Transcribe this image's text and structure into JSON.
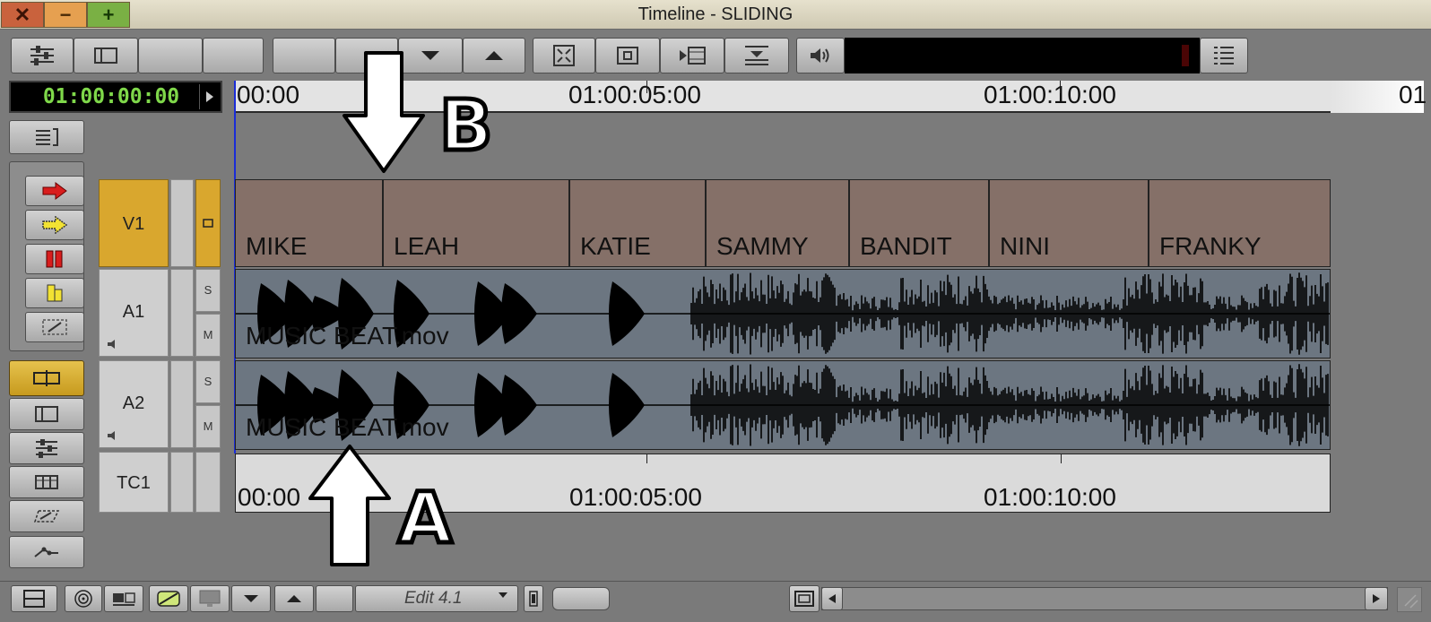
{
  "window": {
    "title": "Timeline - SLIDING",
    "close_icon": "✕",
    "minimize_icon": "−",
    "maximize_icon": "+"
  },
  "timecode": {
    "current": "01:00:00:00"
  },
  "ruler": {
    "labels": [
      "00:00",
      "01:00:05:00",
      "01:00:10:00",
      "01"
    ]
  },
  "tracks": {
    "v1": {
      "name": "V1"
    },
    "a1": {
      "name": "A1",
      "solo": "S",
      "mute": "M"
    },
    "a2": {
      "name": "A2",
      "solo": "S",
      "mute": "M"
    },
    "tc1": {
      "name": "TC1"
    }
  },
  "clips": {
    "video": [
      "MIKE",
      "LEAH",
      "KATIE",
      "SAMMY",
      "BANDIT",
      "NINI",
      "FRANKY"
    ],
    "audio_a1": "MUSIC BEAT.mov",
    "audio_a2": "MUSIC BEAT.mov"
  },
  "tc_track": {
    "labels": [
      "00:00",
      "01:00:05:00",
      "01:00:10:00"
    ]
  },
  "annotations": {
    "a": "A",
    "b": "B"
  },
  "bottom_toolbar": {
    "edit_mode": "Edit 4.1"
  },
  "colors": {
    "video_clip": "#857068",
    "audio_clip": "#6c7681",
    "track_selected": "#d9a72e",
    "timecode_green": "#7fd84a"
  }
}
